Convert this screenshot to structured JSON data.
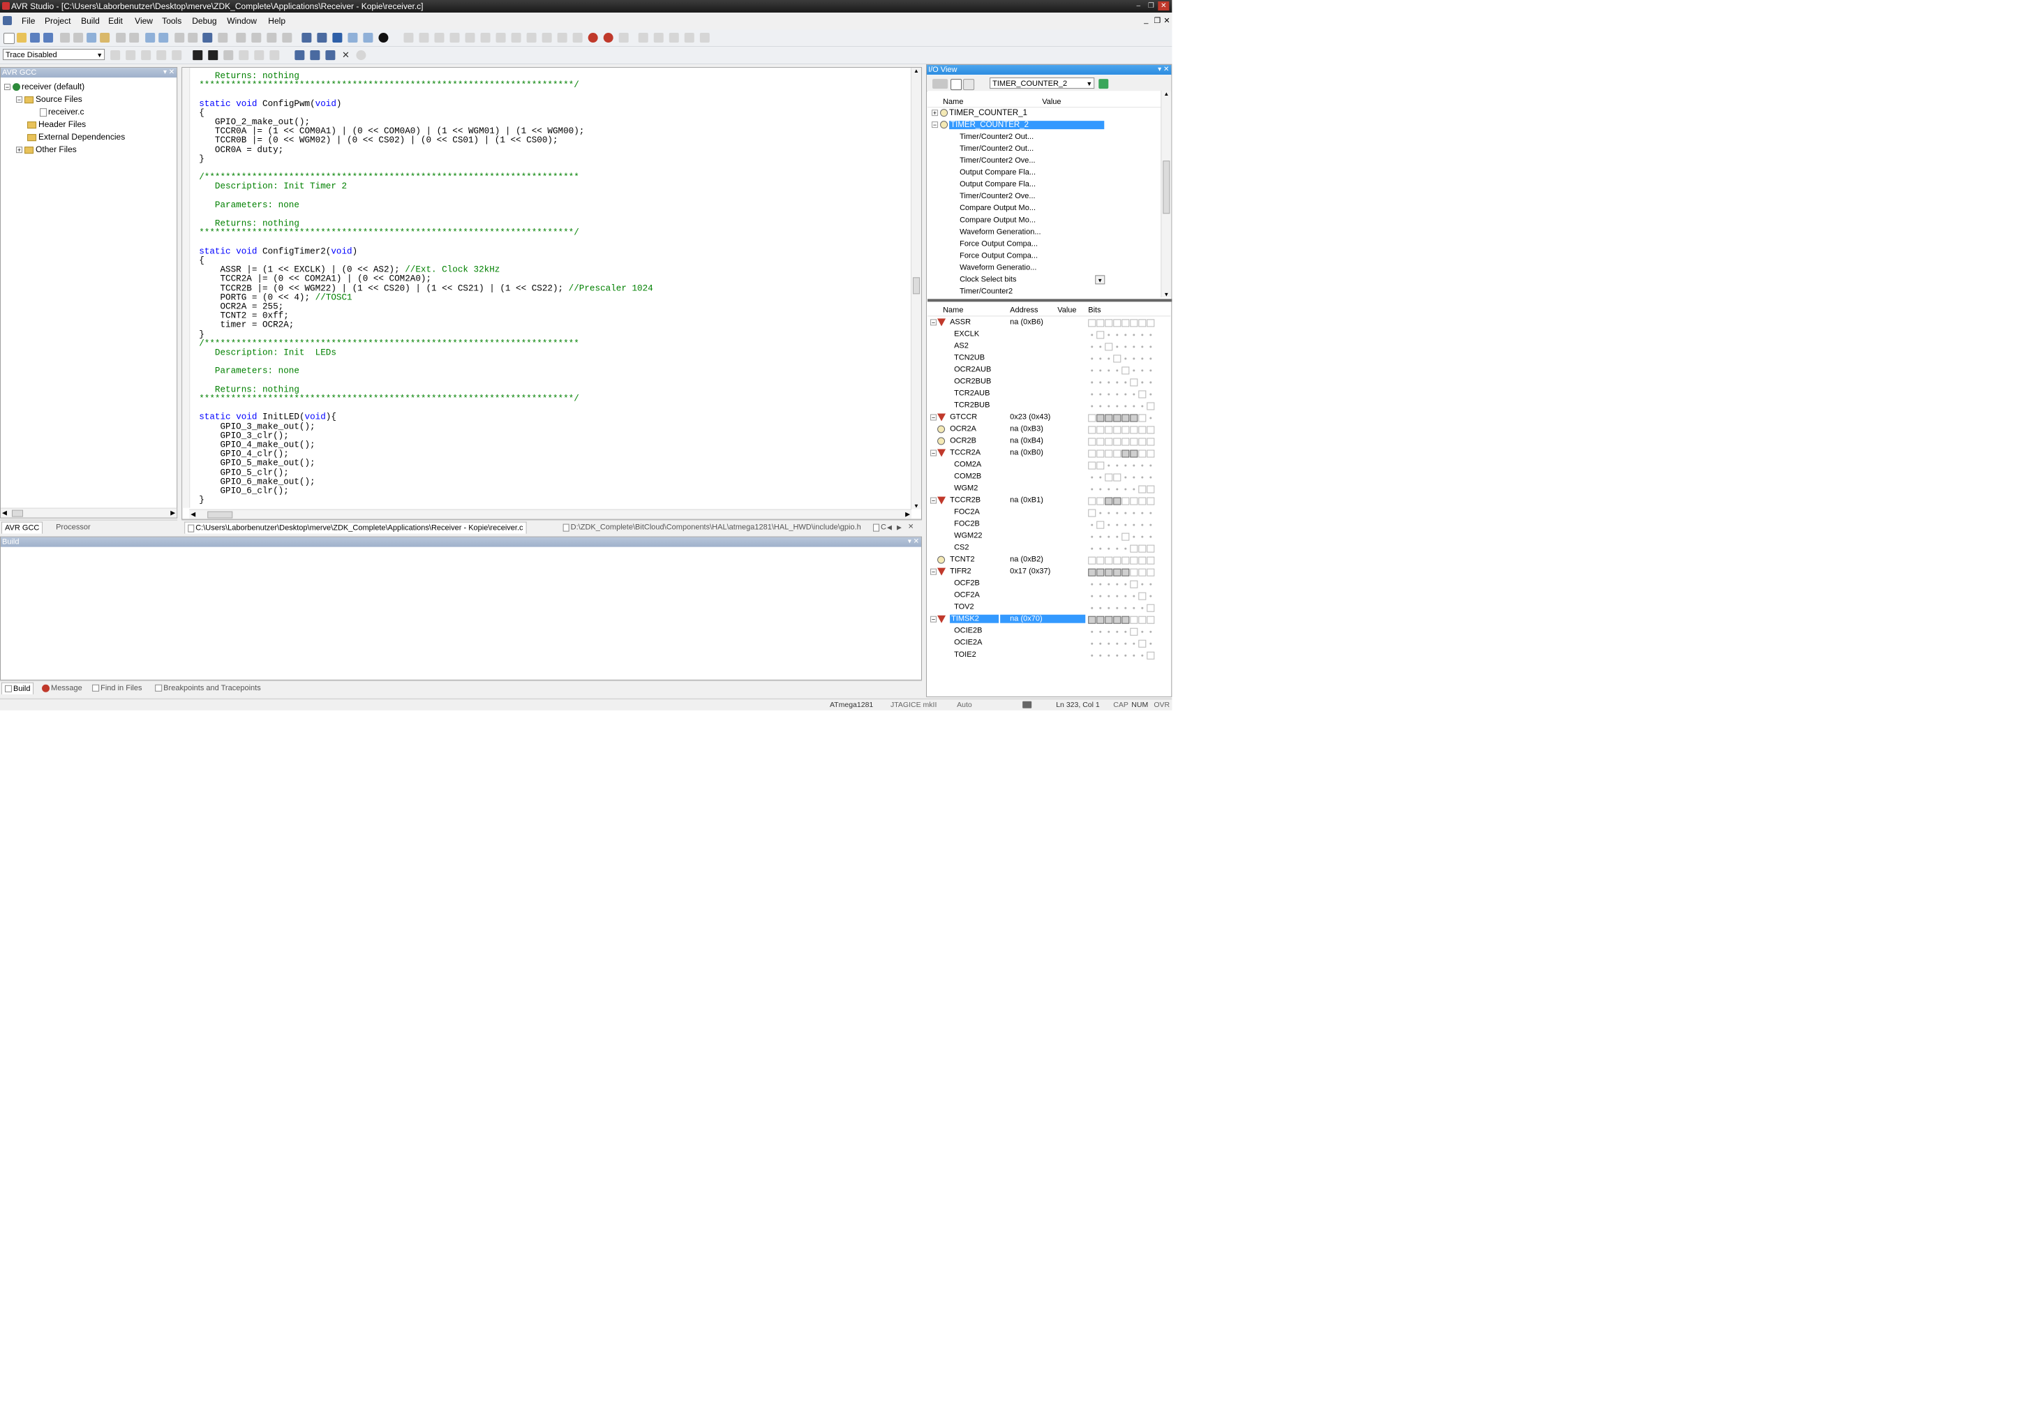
{
  "window": {
    "title": "AVR Studio - [C:\\Users\\Laborbenutzer\\Desktop\\merve\\ZDK_Complete\\Applications\\Receiver - Kopie\\receiver.c]"
  },
  "menu": [
    "File",
    "Project",
    "Build",
    "Edit",
    "View",
    "Tools",
    "Debug",
    "Window",
    "Help"
  ],
  "toolbar": {
    "trace": "Trace Disabled"
  },
  "project_panel": {
    "title": "AVR GCC",
    "root": "receiver (default)",
    "items": [
      "Source Files",
      "receiver.c",
      "Header Files",
      "External Dependencies",
      "Other Files"
    ],
    "tabs": [
      "AVR GCC",
      "Processor"
    ]
  },
  "editor": {
    "lines": [
      {
        "t": "   Returns: nothing",
        "c": "cm"
      },
      {
        "t": "***********************************************************************/",
        "c": "cm"
      },
      {
        "t": "",
        "c": ""
      },
      {
        "t": "static void ConfigPwm(void)",
        "c": "kw"
      },
      {
        "t": "{",
        "c": ""
      },
      {
        "t": "   GPIO_2_make_out();",
        "c": ""
      },
      {
        "t": "   TCCR0A |= (1 << COM0A1) | (0 << COM0A0) | (1 << WGM01) | (1 << WGM00);",
        "c": ""
      },
      {
        "t": "   TCCR0B |= (0 << WGM02) | (0 << CS02) | (0 << CS01) | (1 << CS00);",
        "c": ""
      },
      {
        "t": "   OCR0A = duty;",
        "c": ""
      },
      {
        "t": "}",
        "c": ""
      },
      {
        "t": "",
        "c": ""
      },
      {
        "t": "/***********************************************************************",
        "c": "cm"
      },
      {
        "t": "   Description: Init Timer 2",
        "c": "cm"
      },
      {
        "t": "",
        "c": ""
      },
      {
        "t": "   Parameters: none",
        "c": "cm"
      },
      {
        "t": "",
        "c": ""
      },
      {
        "t": "   Returns: nothing",
        "c": "cm"
      },
      {
        "t": "***********************************************************************/",
        "c": "cm"
      },
      {
        "t": "",
        "c": ""
      },
      {
        "t": "static void ConfigTimer2(void)",
        "c": "kw"
      },
      {
        "t": "{",
        "c": ""
      },
      {
        "t": "    ASSR |= (1 << EXCLK) | (0 << AS2); //Ext. Clock 32kHz",
        "c": "mixc"
      },
      {
        "t": "    TCCR2A |= (0 << COM2A1) | (0 << COM2A0);",
        "c": ""
      },
      {
        "t": "    TCCR2B |= (0 << WGM22) | (1 << CS20) | (1 << CS21) | (1 << CS22); //Prescaler 1024",
        "c": "mixc"
      },
      {
        "t": "    PORTG = (0 << 4); //TOSC1",
        "c": "mixc"
      },
      {
        "t": "    OCR2A = 255;",
        "c": ""
      },
      {
        "t": "    TCNT2 = 0xff;",
        "c": ""
      },
      {
        "t": "    timer = OCR2A;",
        "c": ""
      },
      {
        "t": "}",
        "c": ""
      },
      {
        "t": "/***********************************************************************",
        "c": "cm"
      },
      {
        "t": "   Description: Init  LEDs",
        "c": "cm"
      },
      {
        "t": "",
        "c": ""
      },
      {
        "t": "   Parameters: none",
        "c": "cm"
      },
      {
        "t": "",
        "c": ""
      },
      {
        "t": "   Returns: nothing",
        "c": "cm"
      },
      {
        "t": "***********************************************************************/",
        "c": "cm"
      },
      {
        "t": "",
        "c": ""
      },
      {
        "t": "static void InitLED(void){",
        "c": "kw"
      },
      {
        "t": "    GPIO_3_make_out();",
        "c": ""
      },
      {
        "t": "    GPIO_3_clr();",
        "c": ""
      },
      {
        "t": "    GPIO_4_make_out();",
        "c": ""
      },
      {
        "t": "    GPIO_4_clr();",
        "c": ""
      },
      {
        "t": "    GPIO_5_make_out();",
        "c": ""
      },
      {
        "t": "    GPIO_5_clr();",
        "c": ""
      },
      {
        "t": "    GPIO_6_make_out();",
        "c": ""
      },
      {
        "t": "    GPIO_6_clr();",
        "c": ""
      },
      {
        "t": "}",
        "c": ""
      }
    ],
    "tabs": [
      "C:\\Users\\Laborbenutzer\\Desktop\\merve\\ZDK_Complete\\Applications\\Receiver - Kopie\\receiver.c",
      "D:\\ZDK_Complete\\BitCloud\\Components\\HAL\\atmega1281\\HAL_HWD\\include\\gpio.h",
      "C"
    ]
  },
  "build_panel": {
    "title": "Build",
    "tabs": [
      "Build",
      "Message",
      "Find in Files",
      "Breakpoints and Tracepoints"
    ]
  },
  "io_view": {
    "title": "I/O View",
    "selector": "TIMER_COUNTER_2",
    "top_headers": [
      "Name",
      "Value"
    ],
    "top_items": [
      "TIMER_COUNTER_1",
      "TIMER_COUNTER_2"
    ],
    "top_sub": [
      "Timer/Counter2 Out...",
      "Timer/Counter2 Out...",
      "Timer/Counter2 Ove...",
      "Output Compare Fla...",
      "Output Compare Fla...",
      "Timer/Counter2 Ove...",
      "Compare Output Mo...",
      "Compare Output Mo...",
      "Waveform Generation...",
      "Force Output Compa...",
      "Force Output Compa...",
      "Waveform Generatio...",
      "Clock Select bits",
      "Timer/Counter2"
    ],
    "bottom_headers": [
      "Name",
      "Address",
      "Value",
      "Bits"
    ],
    "rows": [
      {
        "name": "ASSR",
        "addr": "na (0xB6)",
        "kind": "reg",
        "bits": "00000000"
      },
      {
        "name": "EXCLK",
        "addr": "",
        "kind": "bit",
        "bits": "d0dddddd"
      },
      {
        "name": "AS2",
        "addr": "",
        "kind": "bit",
        "bits": "dd0ddddd"
      },
      {
        "name": "TCN2UB",
        "addr": "",
        "kind": "bit",
        "bits": "ddd0dddd"
      },
      {
        "name": "OCR2AUB",
        "addr": "",
        "kind": "bit",
        "bits": "dddd0ddd"
      },
      {
        "name": "OCR2BUB",
        "addr": "",
        "kind": "bit",
        "bits": "ddddd0dd"
      },
      {
        "name": "TCR2AUB",
        "addr": "",
        "kind": "bit",
        "bits": "dddddd0d"
      },
      {
        "name": "TCR2BUB",
        "addr": "",
        "kind": "bit",
        "bits": "ddddddd0"
      },
      {
        "name": "GTCCR",
        "addr": "0x23 (0x43)",
        "kind": "reg",
        "bits": "0111110d"
      },
      {
        "name": "OCR2A",
        "addr": "na (0xB3)",
        "kind": "cnt",
        "bits": "00000000"
      },
      {
        "name": "OCR2B",
        "addr": "na (0xB4)",
        "kind": "cnt",
        "bits": "00000000"
      },
      {
        "name": "TCCR2A",
        "addr": "na (0xB0)",
        "kind": "reg",
        "bits": "00001100"
      },
      {
        "name": "COM2A",
        "addr": "",
        "kind": "bit",
        "bits": "00dddddd"
      },
      {
        "name": "COM2B",
        "addr": "",
        "kind": "bit",
        "bits": "dd00dddd"
      },
      {
        "name": "WGM2",
        "addr": "",
        "kind": "bit",
        "bits": "dddddd00"
      },
      {
        "name": "TCCR2B",
        "addr": "na (0xB1)",
        "kind": "reg",
        "bits": "00110000"
      },
      {
        "name": "FOC2A",
        "addr": "",
        "kind": "bit",
        "bits": "0ddddddd"
      },
      {
        "name": "FOC2B",
        "addr": "",
        "kind": "bit",
        "bits": "d0dddddd"
      },
      {
        "name": "WGM22",
        "addr": "",
        "kind": "bit",
        "bits": "dddd0ddd"
      },
      {
        "name": "CS2",
        "addr": "",
        "kind": "bit",
        "bits": "ddddd000"
      },
      {
        "name": "TCNT2",
        "addr": "na (0xB2)",
        "kind": "cnt",
        "bits": "00000000"
      },
      {
        "name": "TIFR2",
        "addr": "0x17 (0x37)",
        "kind": "reg",
        "bits": "11111000"
      },
      {
        "name": "OCF2B",
        "addr": "",
        "kind": "bit",
        "bits": "ddddd0dd"
      },
      {
        "name": "OCF2A",
        "addr": "",
        "kind": "bit",
        "bits": "dddddd0d"
      },
      {
        "name": "TOV2",
        "addr": "",
        "kind": "bit",
        "bits": "ddddddd0"
      },
      {
        "name": "TIMSK2",
        "addr": "na (0x70)",
        "kind": "reg",
        "bits": "11111000",
        "selected": true
      },
      {
        "name": "OCIE2B",
        "addr": "",
        "kind": "bit",
        "bits": "ddddd0dd"
      },
      {
        "name": "OCIE2A",
        "addr": "",
        "kind": "bit",
        "bits": "dddddd0d"
      },
      {
        "name": "TOIE2",
        "addr": "",
        "kind": "bit",
        "bits": "ddddddd0"
      }
    ]
  },
  "statusbar": {
    "device": "ATmega1281",
    "debugger": "JTAGICE mkII",
    "mode": "Auto",
    "position": "Ln 323, Col 1",
    "cap": "CAP",
    "num": "NUM",
    "ovr": "OVR"
  },
  "colors": {
    "accent": "#3399ff",
    "comment": "#008000",
    "keyword": "#0000ff"
  }
}
